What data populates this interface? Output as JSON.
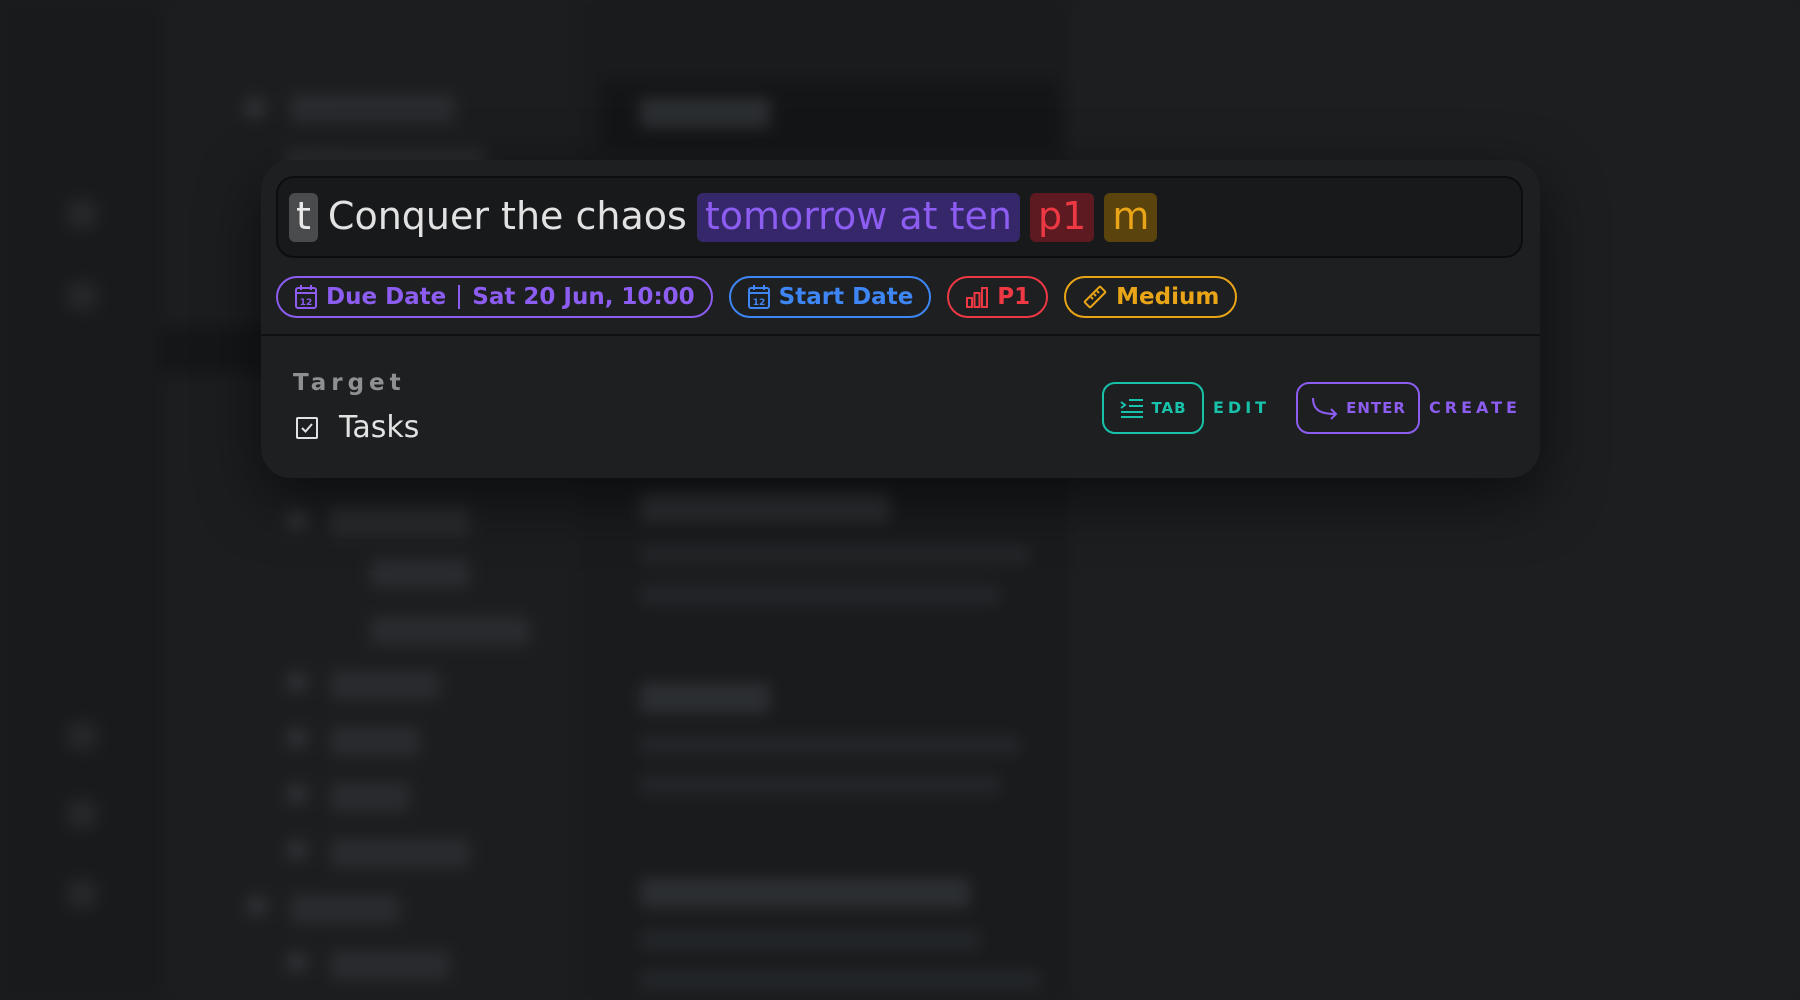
{
  "colors": {
    "purple": "#8c5df0",
    "blue": "#3f86f5",
    "red": "#ee3844",
    "amber": "#e9a517",
    "teal": "#18c2aa"
  },
  "input": {
    "tokens": {
      "trigger": "t",
      "text": "Conquer the chaos",
      "date": "tomorrow at ten",
      "priority": "p1",
      "size": "m"
    }
  },
  "chips": {
    "due": {
      "label": "Due Date",
      "value": "Sat 20 Jun, 10:00",
      "icon": "calendar-icon"
    },
    "start": {
      "label": "Start Date",
      "icon": "calendar-icon"
    },
    "priority": {
      "label": "P1",
      "icon": "bar-chart-icon"
    },
    "effort": {
      "label": "Medium",
      "icon": "ruler-icon"
    }
  },
  "target": {
    "heading": "Target",
    "selected": "Tasks",
    "checked": true
  },
  "shortcuts": {
    "tab": {
      "key": "TAB",
      "caption": "EDIT",
      "icon": "indent-icon"
    },
    "enter": {
      "key": "ENTER",
      "caption": "CREATE",
      "icon": "enter-arrow-icon"
    }
  }
}
